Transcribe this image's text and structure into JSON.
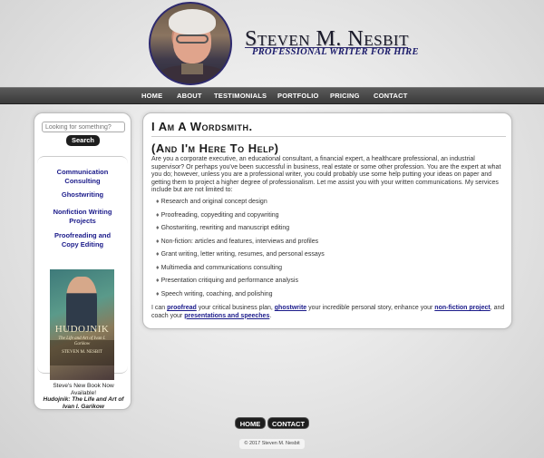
{
  "header": {
    "title": "Steven M. Nesbit",
    "subtitle": "PROFESSIONAL WRITER FOR HIRE"
  },
  "nav": {
    "items": [
      "HOME",
      "ABOUT",
      "TESTIMONIALS",
      "PORTFOLIO",
      "PRICING",
      "CONTACT"
    ]
  },
  "sidebar": {
    "search_placeholder": "Looking for something?",
    "search_button": "Search",
    "links": [
      {
        "line1": "Communication",
        "line2": "Consulting"
      },
      {
        "line1": "Ghostwriting",
        "line2": ""
      },
      {
        "line1": "Nonfiction Writing",
        "line2": "Projects"
      },
      {
        "line1": "Proofreading and",
        "line2": "Copy Editing"
      }
    ],
    "book": {
      "cover_title": "HUDOJNIK",
      "cover_subtitle": "The Life and Art of Ivan I. Garikow",
      "cover_author": "STEVEN M. NESBIT",
      "caption": "Steve's New Book Now Available!",
      "name": "Hudojnik: The Life and Art of Ivan I. Garikow"
    }
  },
  "main": {
    "heading1": "I Am A Wordsmith.",
    "heading2": "(And I'm Here To Help)",
    "intro": "Are you a corporate executive, an educational consultant, a financial expert, a healthcare professional, an industrial supervisor? Or perhaps you've been successful in business, real estate or some other profession. You are the expert at what you do; however, unless you are a professional writer, you could probably use some help putting your ideas on paper and getting them to project a higher degree of professionalism. Let me assist you with your written communications. My services include but are not limited to:",
    "services": [
      "Research and original concept design",
      "Proofreading, copyediting and copywriting",
      "Ghostwriting, rewriting and manuscript editing",
      "Non-fiction: articles and features, interviews and profiles",
      "Grant writing, letter writing, resumes, and personal essays",
      "Multimedia and communications consulting",
      "Presentation critiquing and performance analysis",
      "Speech writing, coaching, and polishing"
    ],
    "closing": {
      "t1": "I can ",
      "l1": "proofread",
      "t2": " your critical business plan, ",
      "l2": "ghostwrite",
      "t3": " your incredible personal story, enhance your ",
      "l3": "non-fiction project",
      "t4": ", and coach your ",
      "l4": "presentations and speeches",
      "t5": "."
    }
  },
  "footer": {
    "home": "HOME",
    "contact": "CONTACT",
    "copyright": "© 2017 Steven M. Nesbit"
  }
}
